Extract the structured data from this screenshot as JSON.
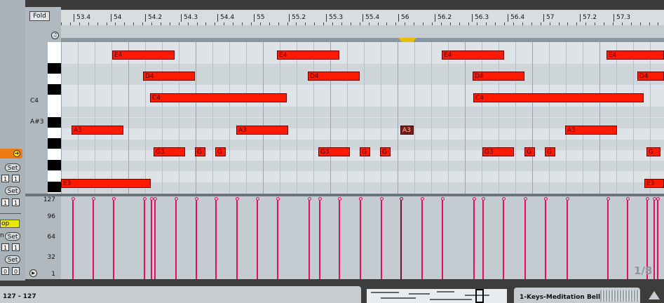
{
  "fold_label": "Fold",
  "ruler": {
    "bars": [
      "53.4",
      "54",
      "54.2",
      "54.3",
      "54.4",
      "55",
      "55.2",
      "55.3",
      "55.4",
      "56",
      "56.2",
      "56.3",
      "56.4",
      "57",
      "57.2",
      "57.3"
    ]
  },
  "key_labels": {
    "c4": "C4",
    "asharp3": "A#3"
  },
  "notes": [
    {
      "pitch": "E4",
      "label": "E4"
    },
    {
      "pitch": "E4",
      "label": "E4"
    },
    {
      "pitch": "E4",
      "label": "E4"
    },
    {
      "pitch": "E4",
      "label": "E4"
    },
    {
      "pitch": "D4",
      "label": "D4"
    },
    {
      "pitch": "D4",
      "label": "D4"
    },
    {
      "pitch": "D4",
      "label": "D4"
    },
    {
      "pitch": "D4",
      "label": "D4"
    },
    {
      "pitch": "C4",
      "label": "C4"
    },
    {
      "pitch": "C4",
      "label": "C4"
    },
    {
      "pitch": "A3",
      "label": "A3"
    },
    {
      "pitch": "A3",
      "label": "A3"
    },
    {
      "pitch": "A3",
      "label": "A3",
      "selected": true
    },
    {
      "pitch": "A3",
      "label": "A3"
    },
    {
      "pitch": "G3",
      "label": "G3"
    },
    {
      "pitch": "G",
      "label": "G"
    },
    {
      "pitch": "G",
      "label": "G"
    },
    {
      "pitch": "G3",
      "label": "G3"
    },
    {
      "pitch": "G",
      "label": "G"
    },
    {
      "pitch": "G",
      "label": "G"
    },
    {
      "pitch": "G3",
      "label": "G3"
    },
    {
      "pitch": "G",
      "label": "G"
    },
    {
      "pitch": "G",
      "label": "G"
    },
    {
      "pitch": "G",
      "label": "G"
    },
    {
      "pitch": "E3",
      "label": "E3"
    },
    {
      "pitch": "E3",
      "label": "E3"
    }
  ],
  "velocity_labels": [
    "127",
    "96",
    "64",
    "32",
    "1"
  ],
  "grid_fraction": "1/8",
  "left_panel": {
    "set_label": "Set",
    "num_one": "1",
    "num_zero": "0",
    "loop_text": "op",
    "h_text": "n"
  },
  "status": {
    "velocity_range": "127 - 127",
    "clip_name": "1-Keys-Meditation Bells"
  },
  "colors": {
    "note": "#ff1a00",
    "velocity": "#e0105a",
    "accent": "#f07a12"
  }
}
